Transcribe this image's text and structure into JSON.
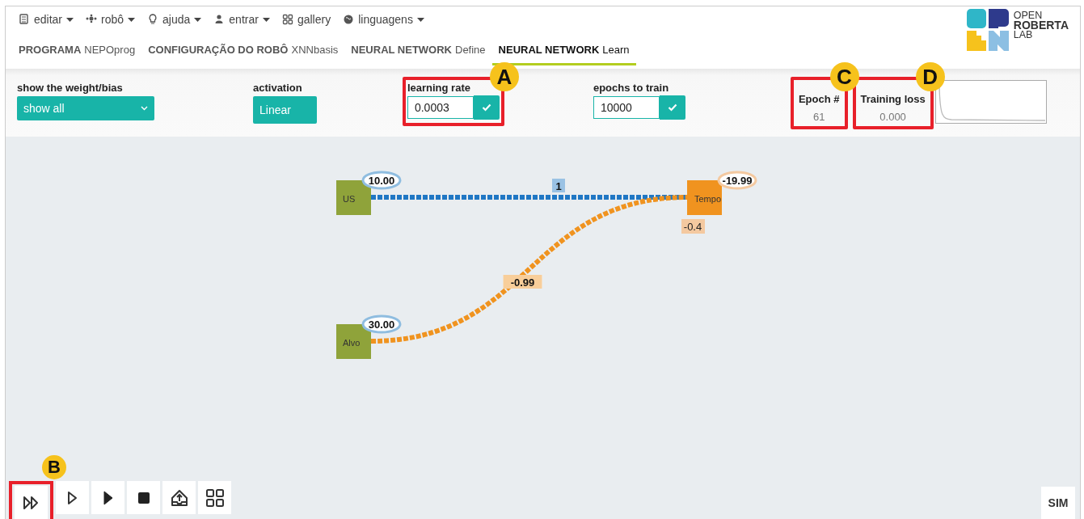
{
  "menu": [
    {
      "label": "editar",
      "kind": "document"
    },
    {
      "label": "robô",
      "kind": "robot"
    },
    {
      "label": "ajuda",
      "kind": "bulb"
    },
    {
      "label": "entrar",
      "kind": "user"
    },
    {
      "label": "gallery",
      "kind": "grid"
    },
    {
      "label": "linguagens",
      "kind": "globe"
    }
  ],
  "logo": {
    "lines": [
      "OPEN",
      "ROBERTA",
      "LAB"
    ]
  },
  "tabs": [
    {
      "title": "PROGRAMA",
      "subtitle": "NEPOprog",
      "selected": false
    },
    {
      "title": "CONFIGURAÇÃO DO ROBÔ",
      "subtitle": "XNNbasis",
      "selected": false
    },
    {
      "title": "NEURAL NETWORK",
      "subtitle": "Define",
      "selected": false
    },
    {
      "title": "NEURAL NETWORK",
      "subtitle": "Learn",
      "selected": true
    }
  ],
  "controls": {
    "weight_bias": {
      "label": "show the weight/bias",
      "value": "show all"
    },
    "activation": {
      "label": "activation",
      "value": "Linear"
    },
    "learning_rate": {
      "label": "learning rate",
      "value": "0.0003",
      "callout": "A"
    },
    "epochs": {
      "label": "epochs to train",
      "value": "10000"
    },
    "epoch": {
      "label": "Epoch #",
      "value": "61",
      "callout": "C"
    },
    "training_loss": {
      "label": "Training loss",
      "value": "0.000",
      "callout": "D"
    }
  },
  "network": {
    "nodes": [
      {
        "name": "US",
        "kind": "input",
        "value": "10.00"
      },
      {
        "name": "Alvo",
        "kind": "input",
        "value": "30.00"
      },
      {
        "name": "Tempo",
        "kind": "output",
        "value": "-19.99",
        "bias": "-0.4"
      }
    ],
    "edges": [
      {
        "weight": "1",
        "color": "#1f77c4"
      },
      {
        "weight": "-0.99",
        "color": "#f0931f"
      }
    ]
  },
  "toolbar": [
    {
      "kind": "run-all",
      "callout": "B"
    },
    {
      "kind": "step"
    },
    {
      "kind": "play"
    },
    {
      "kind": "stop"
    },
    {
      "kind": "upload"
    },
    {
      "kind": "apps"
    }
  ],
  "sim_button": "SIM"
}
